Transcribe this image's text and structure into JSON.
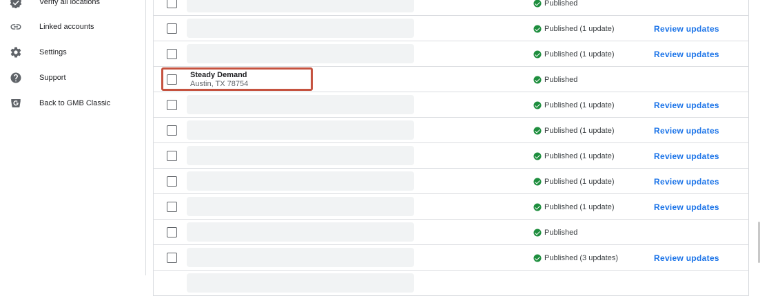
{
  "sidebar": {
    "items": [
      {
        "label": "Verify all locations",
        "icon": "verified-check-icon"
      },
      {
        "label": "Linked accounts",
        "icon": "link-icon"
      },
      {
        "label": "Settings",
        "icon": "gear-icon"
      },
      {
        "label": "Support",
        "icon": "help-icon"
      },
      {
        "label": "Back to GMB Classic",
        "icon": "gmb-icon"
      }
    ]
  },
  "locations": {
    "rows": [
      {
        "status": "Published",
        "action": ""
      },
      {
        "status": "Published (1 update)",
        "action": "Review updates"
      },
      {
        "status": "Published (1 update)",
        "action": "Review updates"
      },
      {
        "name": "Steady Demand",
        "address": "Austin, TX 78754",
        "status": "Published",
        "action": ""
      },
      {
        "status": "Published (1 update)",
        "action": "Review updates"
      },
      {
        "status": "Published (1 update)",
        "action": "Review updates"
      },
      {
        "status": "Published (1 update)",
        "action": "Review updates"
      },
      {
        "status": "Published (1 update)",
        "action": "Review updates"
      },
      {
        "status": "Published (1 update)",
        "action": "Review updates"
      },
      {
        "status": "Published",
        "action": ""
      },
      {
        "status": "Published (3 updates)",
        "action": "Review updates"
      }
    ]
  },
  "colors": {
    "status_green": "#1e8e3e",
    "link_blue": "#1a73e8",
    "highlight_red": "#c5523f"
  }
}
